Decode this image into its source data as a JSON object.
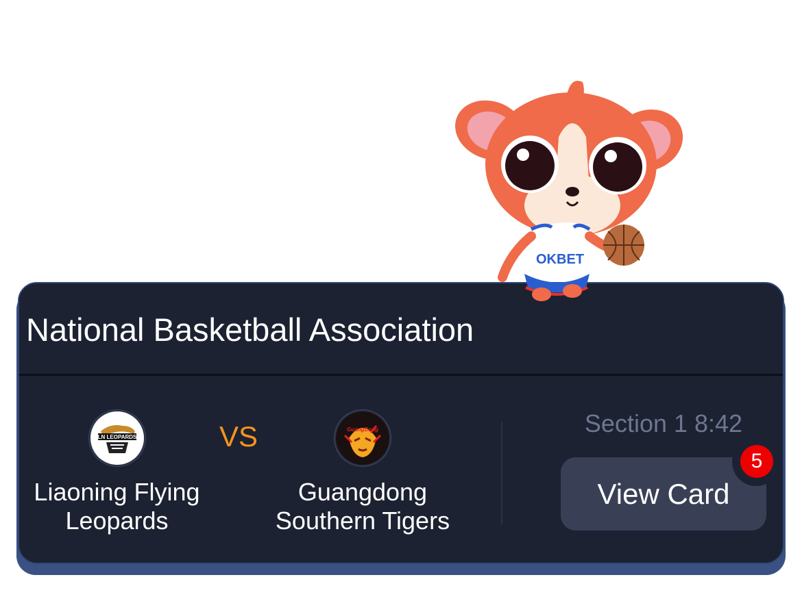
{
  "league": {
    "title": "National Basketball Association"
  },
  "match": {
    "home": {
      "name": "Liaoning Flying Leopards",
      "logo_text": "LN LEOPARDS",
      "logo_icon": "leopard-logo"
    },
    "vs_label": "VS",
    "away": {
      "name": "Guangdong Southern Tigers",
      "logo_text": "GuangDong",
      "logo_icon": "tiger-logo"
    },
    "status": "Section 1 8:42"
  },
  "actions": {
    "view_card_label": "View Card",
    "card_count": "5"
  },
  "mascot": {
    "icon": "okbet-mascot",
    "jersey_text": "OKBET"
  },
  "colors": {
    "card_bg": "#1c2231",
    "vs": "#f7931e",
    "badge": "#ee0000",
    "button": "#394056",
    "border": "#2f4679"
  }
}
